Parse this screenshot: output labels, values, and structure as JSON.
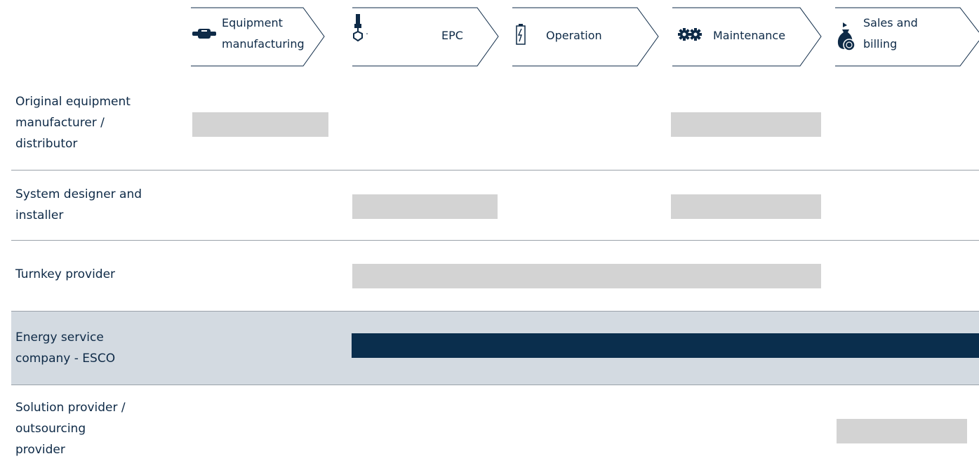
{
  "value_chain": {
    "steps": [
      {
        "label": "Equipment manufacturing",
        "lines": [
          "Equipment",
          "manufacturing"
        ],
        "icon": "pipe-fitting-icon"
      },
      {
        "label": "EPC",
        "lines": [
          "EPC"
        ],
        "icon": "crane-hook-icon"
      },
      {
        "label": "Operation",
        "lines": [
          "Operation"
        ],
        "icon": "battery-icon"
      },
      {
        "label": "Maintenance",
        "lines": [
          "Maintenance"
        ],
        "icon": "gears-icon"
      },
      {
        "label": "Sales and billing",
        "lines": [
          "Sales and",
          "billing"
        ],
        "icon": "money-bag-icon"
      }
    ]
  },
  "actors": [
    {
      "name": "Original equipment manufacturer / distributor",
      "lines": [
        "Original equipment",
        "manufacturer /",
        "distributor"
      ],
      "covers": [
        "Equipment manufacturing",
        "Maintenance"
      ],
      "highlight": false
    },
    {
      "name": "System designer and installer",
      "lines": [
        "System designer and",
        "installer"
      ],
      "covers": [
        "EPC",
        "Maintenance"
      ],
      "highlight": false
    },
    {
      "name": "Turnkey provider",
      "lines": [
        "Turnkey provider"
      ],
      "covers": [
        "EPC",
        "Operation",
        "Maintenance"
      ],
      "highlight": false
    },
    {
      "name": "Energy service company - ESCO",
      "lines": [
        "Energy service",
        "company - ESCO"
      ],
      "covers": [
        "EPC",
        "Operation",
        "Maintenance",
        "Sales and billing"
      ],
      "highlight": true
    },
    {
      "name": "Solution provider / outsourcing provider",
      "lines": [
        "Solution provider /",
        "outsourcing",
        "provider"
      ],
      "covers": [
        "Sales and billing"
      ],
      "highlight": false
    }
  ],
  "colors": {
    "text": "#0e2a47",
    "bar": "#d3d3d3",
    "highlight_bar": "#0a2e4d",
    "highlight_band": "#d3dae1",
    "separator": "#9aa2aa"
  }
}
